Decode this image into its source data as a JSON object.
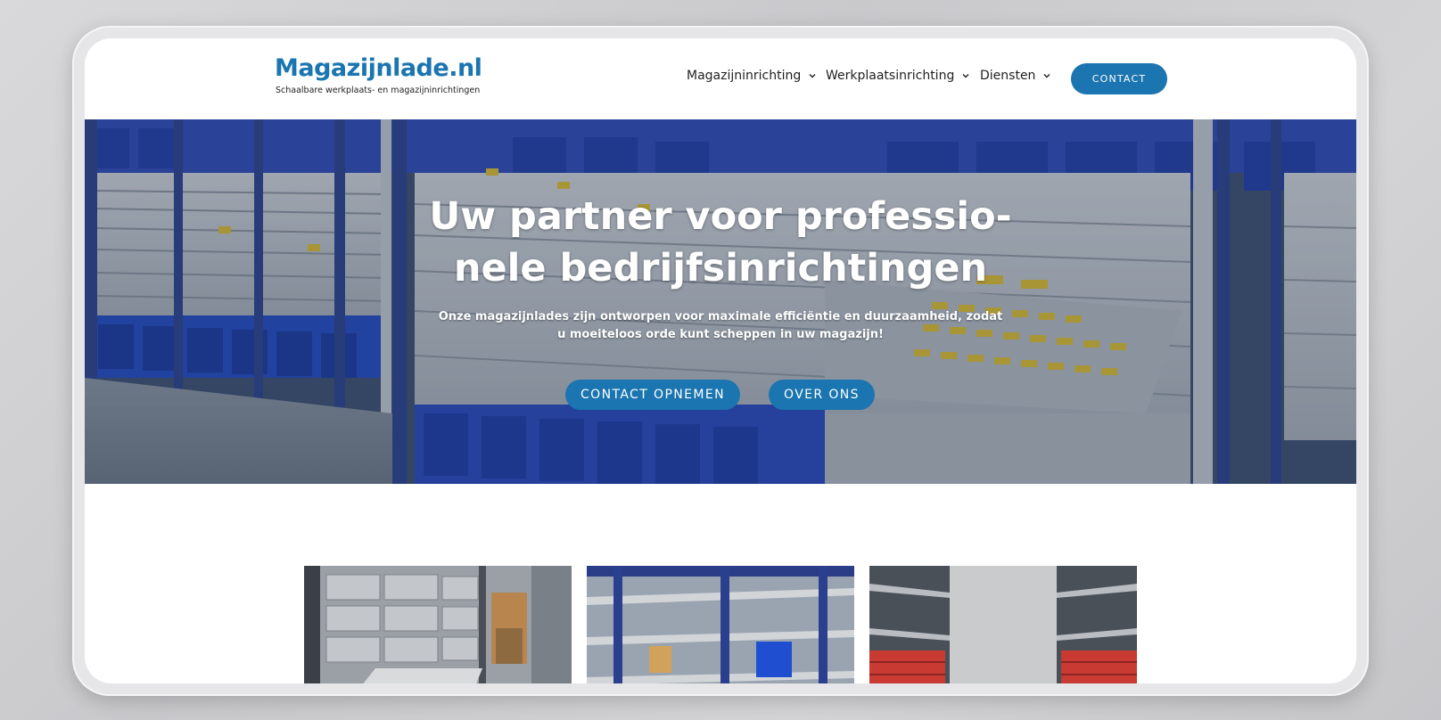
{
  "header": {
    "logo_title": "Magazijnlade.nl",
    "logo_tagline": "Schaalbare werkplaats- en magazijninrichtingen",
    "nav": [
      {
        "label": "Magazijninrichting"
      },
      {
        "label": "Werkplaatsinrichting"
      },
      {
        "label": "Diensten"
      }
    ],
    "contact_label": "CONTACT"
  },
  "hero": {
    "title_line1": "Uw partner voor professio-",
    "title_line2": "nele bedrijfsinrichtingen",
    "subtitle_line1": "Onze magazijnlades zijn ontworpen voor maximale efficiëntie en duurzaamheid, zodat",
    "subtitle_line2": "u moeiteloos orde kunt scheppen in uw magazijn!",
    "button_contact": "CONTACT OPNEMEN",
    "button_about": "OVER ONS"
  },
  "colors": {
    "brand_blue": "#1a75b0",
    "rack_blue": "#243f8f",
    "bin_blue": "#1f4fd0",
    "drawer_grey": "#c9cdd1",
    "label_yellow": "#e5c22a"
  },
  "cards": [
    {
      "icon": "warehouse-bins-photo"
    },
    {
      "icon": "shelving-photo"
    },
    {
      "icon": "drawer-cabinet-photo"
    }
  ]
}
